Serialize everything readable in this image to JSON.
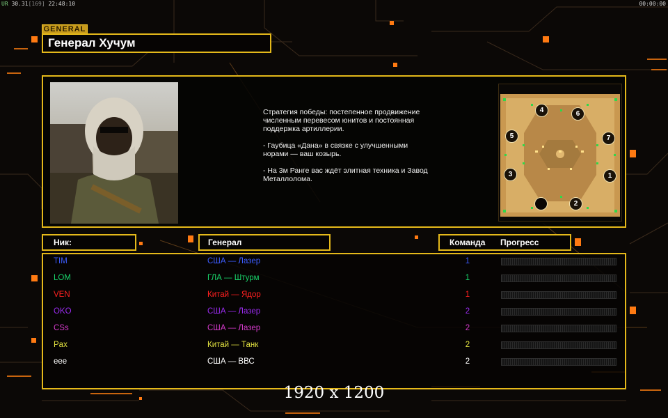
{
  "hud": {
    "fps_label": "UR",
    "fps_value": "30.31",
    "frame_info": "[169]",
    "clock": "22:48:10",
    "timer": "00:00:00"
  },
  "general": {
    "tag": "GENERAL",
    "name": "Генерал Хучум",
    "strategy": "Стратегия победы: постепенное продвижение численным перевесом юнитов и постоянная поддержка артиллерии.\n\n- Гаубица «Дана» в связке с улучшенными норами — ваш козырь.\n\n- На 3м Ранге вас ждёт элитная техника и Завод Металлолома."
  },
  "minimap": {
    "spawn_labels": [
      "1",
      "2",
      "3",
      "4",
      "5",
      "6",
      "7"
    ]
  },
  "table": {
    "headers": {
      "nick": "Ник:",
      "general": "Генерал",
      "team": "Команда",
      "progress": "Прогресс"
    },
    "rows": [
      {
        "nick": "TIM",
        "general": "США — Лазер",
        "team": "1",
        "color": "#3c5cff",
        "progress": 0
      },
      {
        "nick": "LOM",
        "general": "ГЛА — Штурм",
        "team": "1",
        "color": "#19d36a",
        "progress": 0
      },
      {
        "nick": "VEN",
        "general": "Китай — Ядор",
        "team": "1",
        "color": "#ff2020",
        "progress": 0
      },
      {
        "nick": "OKO",
        "general": "США — Лазер",
        "team": "2",
        "color": "#9a2cf0",
        "progress": 0
      },
      {
        "nick": "CSs",
        "general": "США — Лазер",
        "team": "2",
        "color": "#d23ac8",
        "progress": 0
      },
      {
        "nick": "Pax",
        "general": "Китай — Танк",
        "team": "2",
        "color": "#e0e040",
        "progress": 0
      },
      {
        "nick": "eee",
        "general": "США — ВВС",
        "team": "2",
        "color": "#ffffff",
        "progress": 0
      }
    ]
  },
  "resolution_text": "1920 x 1200",
  "colors": {
    "accent": "#e5b91a",
    "orange": "#ff7a12"
  }
}
